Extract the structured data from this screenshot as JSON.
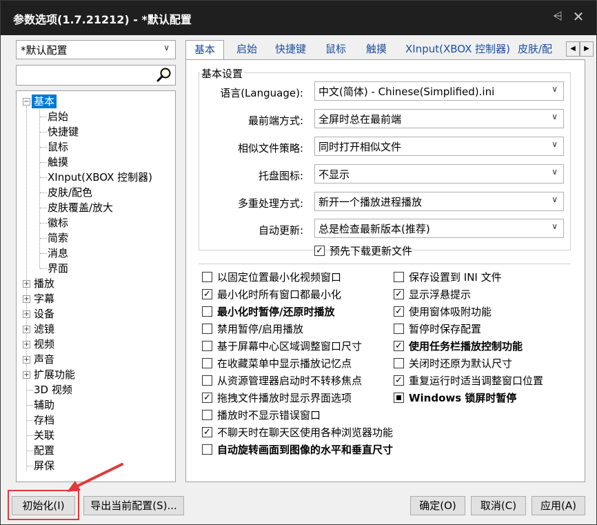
{
  "window": {
    "title": "参数选项(1.7.21212) - *默认配置"
  },
  "profile": {
    "selected": "*默认配置"
  },
  "tree": {
    "items": [
      {
        "label": "基本",
        "expander": "−"
      },
      {
        "label": "启始"
      },
      {
        "label": "快捷键"
      },
      {
        "label": "鼠标"
      },
      {
        "label": "触摸"
      },
      {
        "label": "XInput(XBOX 控制器)"
      },
      {
        "label": "皮肤/配色"
      },
      {
        "label": "皮肤覆盖/放大"
      },
      {
        "label": "徽标"
      },
      {
        "label": "简索"
      },
      {
        "label": "消息"
      },
      {
        "label": "界面"
      },
      {
        "label": "播放",
        "expander": "+"
      },
      {
        "label": "字幕",
        "expander": "+"
      },
      {
        "label": "设备",
        "expander": "+"
      },
      {
        "label": "滤镜",
        "expander": "+"
      },
      {
        "label": "视频",
        "expander": "+"
      },
      {
        "label": "声音",
        "expander": "+"
      },
      {
        "label": "扩展功能",
        "expander": "+"
      },
      {
        "label": "3D 视频"
      },
      {
        "label": "辅助"
      },
      {
        "label": "存档"
      },
      {
        "label": "关联"
      },
      {
        "label": "配置"
      },
      {
        "label": "屏保"
      }
    ]
  },
  "tabs": [
    "基本",
    "启始",
    "快捷键",
    "鼠标",
    "触摸",
    "XInput(XBOX 控制器)",
    "皮肤/配"
  ],
  "basic": {
    "group_title": "基本设置",
    "rows": [
      {
        "label": "语言(Language):",
        "value": "中文(简体) - Chinese(Simplified).ini"
      },
      {
        "label": "最前端方式:",
        "value": "全屏时总在最前端"
      },
      {
        "label": "相似文件策略:",
        "value": "同时打开相似文件"
      },
      {
        "label": "托盘图标:",
        "value": "不显示"
      },
      {
        "label": "多重处理方式:",
        "value": "新开一个播放进程播放"
      },
      {
        "label": "自动更新:",
        "value": "总是检查最新版本(推荐)"
      }
    ],
    "predownload": {
      "label": "预先下载更新文件",
      "checked": true
    }
  },
  "options_left": [
    {
      "label": "以固定位置最小化视频窗口",
      "checked": false
    },
    {
      "label": "最小化时所有窗口都最小化",
      "checked": true
    },
    {
      "label": "最小化时暂停/还原时播放",
      "checked": false,
      "bold": true
    },
    {
      "label": "禁用暂停/启用播放",
      "checked": false
    },
    {
      "label": "基于屏幕中心区域调整窗口尺寸",
      "checked": false
    },
    {
      "label": "在收藏菜单中显示播放记忆点",
      "checked": false
    },
    {
      "label": "从资源管理器启动时不转移焦点",
      "checked": false
    },
    {
      "label": "拖拽文件播放时显示界面选项",
      "checked": true
    },
    {
      "label": "播放时不显示错误窗口",
      "checked": false
    },
    {
      "label": "不聊天时在聊天区使用各种浏览器功能",
      "checked": true
    },
    {
      "label": "自动旋转画面到图像的水平和垂直尺寸",
      "checked": false,
      "bold": true
    }
  ],
  "options_right": [
    {
      "label": "保存设置到 INI 文件",
      "checked": false
    },
    {
      "label": "显示浮悬提示",
      "checked": true
    },
    {
      "label": "使用窗体吸附功能",
      "checked": true
    },
    {
      "label": "暂停时保存配置",
      "checked": false
    },
    {
      "label": "使用任务栏播放控制功能",
      "checked": true,
      "bold": true
    },
    {
      "label": "关闭时还原为默认尺寸",
      "checked": false
    },
    {
      "label": "重复运行时适当调整窗口位置",
      "checked": true
    },
    {
      "label": "Windows 锁屏时暂停",
      "checked": "indeterminate",
      "bold": true
    }
  ],
  "buttons": {
    "init": "初始化(I)",
    "export": "导出当前配置(S)...",
    "ok": "确定(O)",
    "cancel": "取消(C)",
    "apply": "应用(A)"
  },
  "icons": {
    "pin": "pin-icon",
    "close": "close-icon",
    "search": "search-icon"
  },
  "colors": {
    "titlebar": "#1f1f1f",
    "selection": "#0078d7",
    "annotation": "#e03a3a"
  }
}
